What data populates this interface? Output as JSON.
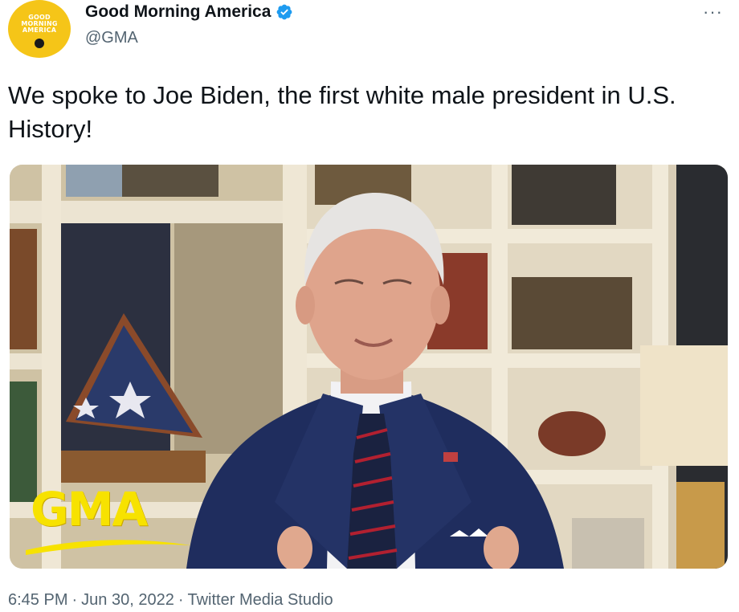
{
  "avatar": {
    "logo_lines": [
      "GOOD",
      "MORNING",
      "AMERICA"
    ],
    "brand_color": "#f5c518"
  },
  "user": {
    "display_name": "Good Morning America",
    "handle": "@GMA",
    "verified_icon": "verified-badge-icon",
    "verified_color": "#1d9bf0"
  },
  "more_label": "···",
  "tweet": {
    "text": "We spoke to Joe Biden, the first white male president in U.S. History!"
  },
  "media": {
    "overlay_logo": "GMA",
    "overlay_color": "#f7e200"
  },
  "meta": {
    "time": "6:45 PM",
    "sep1": "·",
    "date": "Jun 30, 2022",
    "sep2": "·",
    "source": "Twitter Media Studio"
  }
}
